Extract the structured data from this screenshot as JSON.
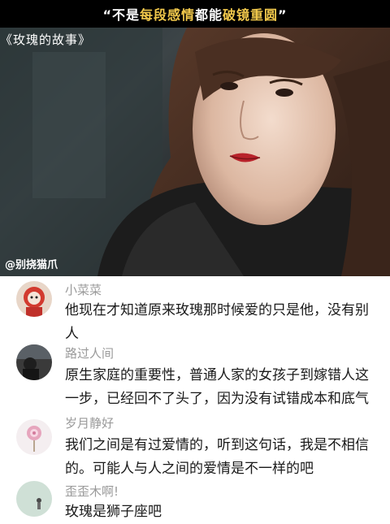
{
  "banner": {
    "prefix": "“不是",
    "highlight1": "每段感情",
    "middle": "都能",
    "highlight2": "破镜重圆",
    "suffix": "”"
  },
  "video": {
    "title": "《玫瑰的故事》",
    "watermark": "@别挠猫爪"
  },
  "comments": [
    {
      "username": "小菜菜",
      "text": "他现在才知道原来玫瑰那时候爱的只是他，没有别人"
    },
    {
      "username": "路过人间",
      "text": "原生家庭的重要性，普通人家的女孩子到嫁错人这一步，已经回不了头了，因为没有试错成本和底气"
    },
    {
      "username": "岁月静好",
      "text": "我们之间是有过爱情的，听到这句话，我是不相信的。可能人与人之间的爱情是不一样的吧"
    },
    {
      "username": "歪歪木啊!",
      "text": "玫瑰是狮子座吧"
    }
  ],
  "colors": {
    "banner_bg": "#000000",
    "highlight": "#f2c94c",
    "username": "#9a9a9a",
    "text": "#1a1a1a"
  }
}
